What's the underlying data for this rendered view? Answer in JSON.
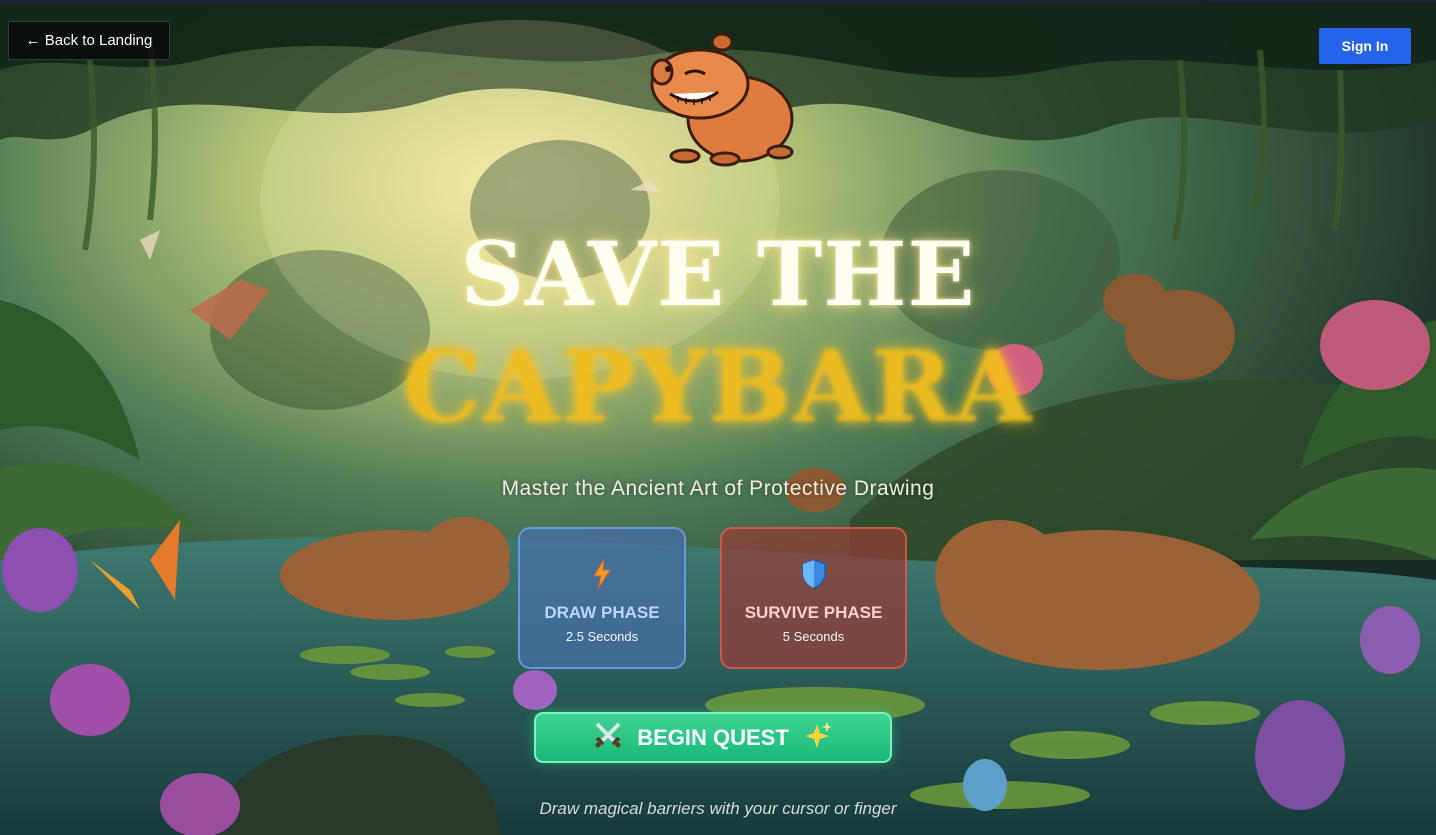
{
  "nav": {
    "back_label": "← Back to Landing",
    "signin_label": "Sign In"
  },
  "hero": {
    "title_line1": "SAVE THE",
    "title_line2": "CAPYBARA",
    "subtitle": "Master the Ancient Art of Protective Drawing"
  },
  "phases": [
    {
      "icon": "lightning-icon",
      "label": "DRAW PHASE",
      "duration": "2.5 Seconds",
      "color": "#466eaa"
    },
    {
      "icon": "shield-icon",
      "label": "SURVIVE PHASE",
      "duration": "5 Seconds",
      "color": "#963c37"
    }
  ],
  "cta": {
    "label": "BEGIN QUEST",
    "left_icon": "crossed-swords-icon",
    "right_icon": "sparkles-icon",
    "color": "#1fbf7f"
  },
  "footer": {
    "hint": "Draw magical barriers with your cursor or finger"
  },
  "colors": {
    "signin": "#2563eb",
    "title_gold": "#f2bd1e"
  }
}
